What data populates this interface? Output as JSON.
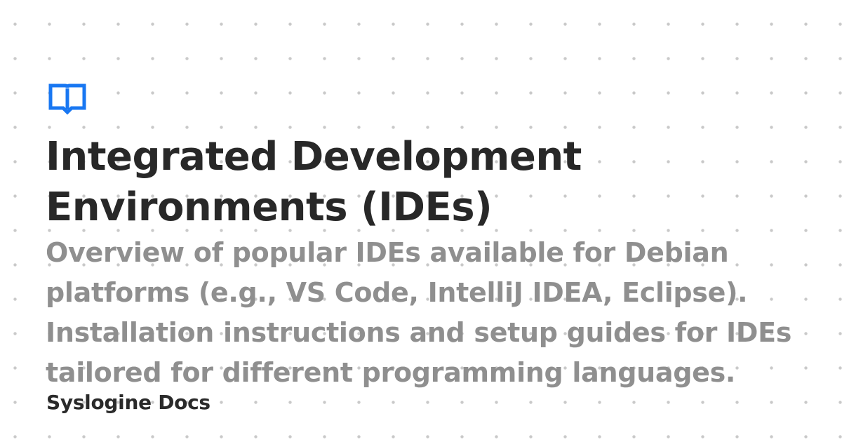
{
  "card": {
    "title": "Integrated Development Environments (IDEs)",
    "description": "Overview of popular IDEs available for Debian platforms (e.g., VS Code, IntelliJ IDEA, Eclipse). Installation instructions and setup guides for IDEs tailored for different programming languages.",
    "site_name": "Syslogine Docs"
  },
  "icons": {
    "logo": "book-icon"
  },
  "colors": {
    "accent": "#1877f2",
    "title": "#282828",
    "description": "#8f8f8f",
    "background": "#ffffff",
    "dots": "#c9c9c9"
  }
}
